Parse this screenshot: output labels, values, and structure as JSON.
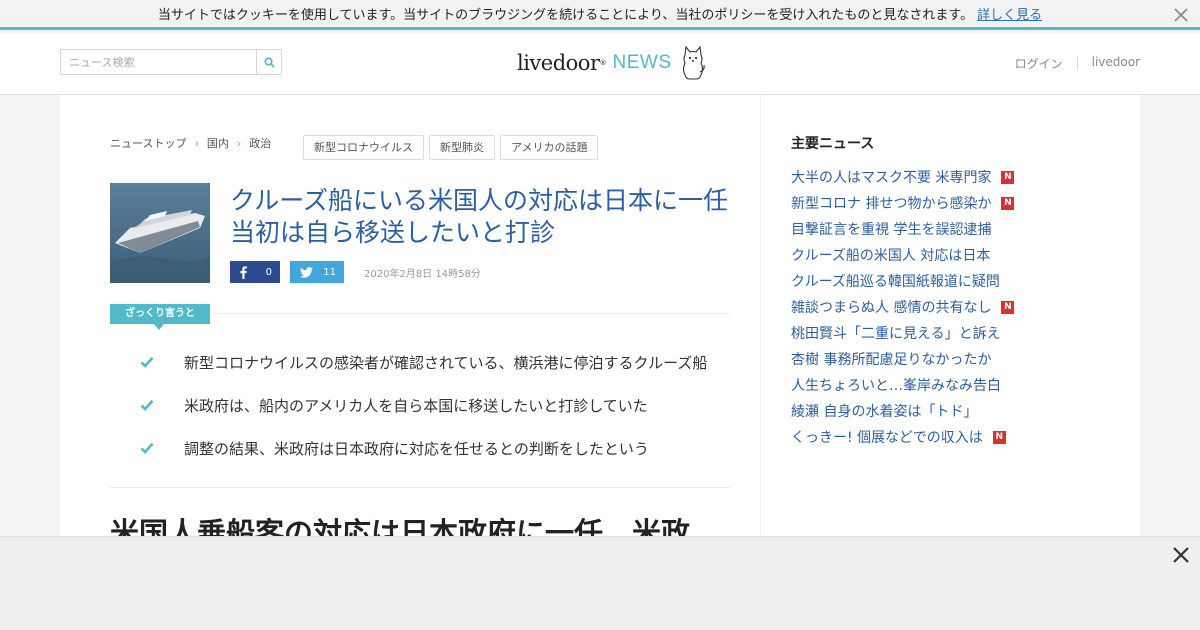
{
  "cookie_bar": {
    "message": "当サイトではクッキーを使用しています。当サイトのブラウジングを続けることにより、当社のポリシーを受け入れたものと見なされます。",
    "link": "詳しく見る",
    "close_icon": "close-icon"
  },
  "header": {
    "search": {
      "placeholder": "ニュース検索",
      "icon": "search-icon"
    },
    "logo": {
      "brand": "livedoor",
      "sup": "®",
      "product": "NEWS"
    },
    "links": [
      "ログイン",
      "livedoor"
    ]
  },
  "article": {
    "breadcrumb": [
      "ニューストップ",
      "国内",
      "政治"
    ],
    "tags": [
      "新型コロナウイルス",
      "新型肺炎",
      "アメリカの話題"
    ],
    "title": "クルーズ船にいる米国人の対応は日本に一任 当初は自ら移送したいと打診",
    "share": {
      "facebook_count": "0",
      "twitter_count": "11"
    },
    "date": "2020年2月8日 14時58分",
    "summary_label": "ざっくり言うと",
    "points": [
      "新型コロナウイルスの感染者が確認されている、横浜港に停泊するクルーズ船",
      "米政府は、船内のアメリカ人を自ら本国に移送したいと打診していた",
      "調整の結果、米政府は日本政府に対応を任せるとの判断をしたという"
    ],
    "headline2": "米国人乗船客の対応は日本政府に一任　米政"
  },
  "sidebar": {
    "title": "主要ニュース",
    "news": [
      {
        "text": "大半の人はマスク不要 米専門家",
        "new": true
      },
      {
        "text": "新型コロナ 排せつ物から感染か",
        "new": true
      },
      {
        "text": "目撃証言を重視 学生を誤認逮捕",
        "new": false
      },
      {
        "text": "クルーズ船の米国人 対応は日本",
        "new": false
      },
      {
        "text": "クルーズ船巡る韓国紙報道に疑問",
        "new": false
      },
      {
        "text": "雑談つまらぬ人 感情の共有なし",
        "new": true
      },
      {
        "text": "桃田賢斗「二重に見える」と訴え",
        "new": false
      },
      {
        "text": "杏樹 事務所配慮足りなかったか",
        "new": false
      },
      {
        "text": "人生ちょろいと…峯岸みなみ告白",
        "new": false
      },
      {
        "text": "綾瀬 自身の水着姿は「トド」",
        "new": false
      },
      {
        "text": "くっきー! 個展などでの収入は",
        "new": true
      }
    ],
    "badge_label": "N"
  },
  "colors": {
    "accent": "#51b9c9",
    "link": "#2a5fa3",
    "facebook": "#2b4a8f",
    "twitter": "#42a8dc",
    "new_badge": "#d93030"
  }
}
